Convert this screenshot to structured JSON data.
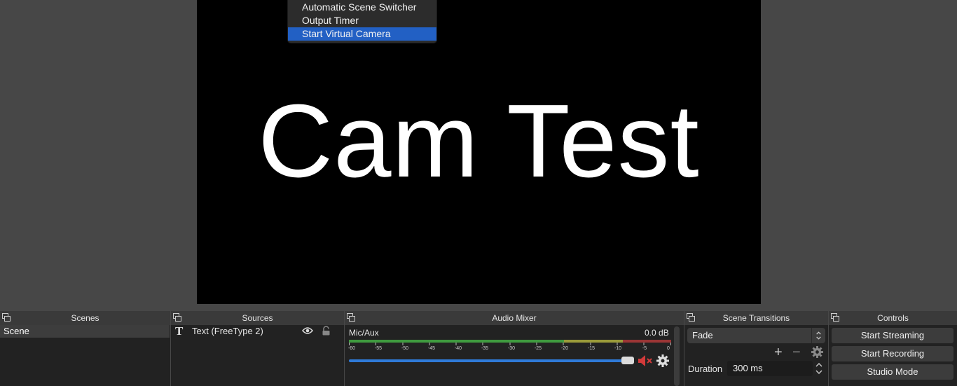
{
  "preview": {
    "text": "Cam Test"
  },
  "tools_menu": {
    "items": [
      {
        "label": "Automatic Scene Switcher",
        "selected": false
      },
      {
        "label": "Output Timer",
        "selected": false
      },
      {
        "label": "Start Virtual Camera",
        "selected": true
      }
    ]
  },
  "docks": {
    "scenes": {
      "title": "Scenes",
      "items": [
        "Scene"
      ]
    },
    "sources": {
      "title": "Sources",
      "items": [
        {
          "label": "Text (FreeType 2)",
          "icon": "text-source-icon",
          "visible": true,
          "locked": false
        }
      ]
    },
    "audio_mixer": {
      "title": "Audio Mixer",
      "channel": {
        "name": "Mic/Aux",
        "level": "0.0 dB",
        "volume_fraction": 1.0,
        "muted": true
      },
      "ticks": [
        "-60",
        "-55",
        "-50",
        "-45",
        "-40",
        "-35",
        "-30",
        "-25",
        "-20",
        "-15",
        "-10",
        "-5",
        "0"
      ]
    },
    "scene_transitions": {
      "title": "Scene Transitions",
      "selected": "Fade",
      "duration_label": "Duration",
      "duration_value": "300 ms"
    },
    "controls": {
      "title": "Controls",
      "buttons": [
        "Start Streaming",
        "Start Recording",
        "Studio Mode"
      ]
    }
  },
  "colors": {
    "menu_highlight": "#2260c4",
    "meter_green": "#3f9a3f",
    "meter_yellow": "#9a9a3a",
    "meter_red": "#9a3535",
    "volume_blue": "#2f7ad8",
    "mute_red": "#d23a3a"
  }
}
